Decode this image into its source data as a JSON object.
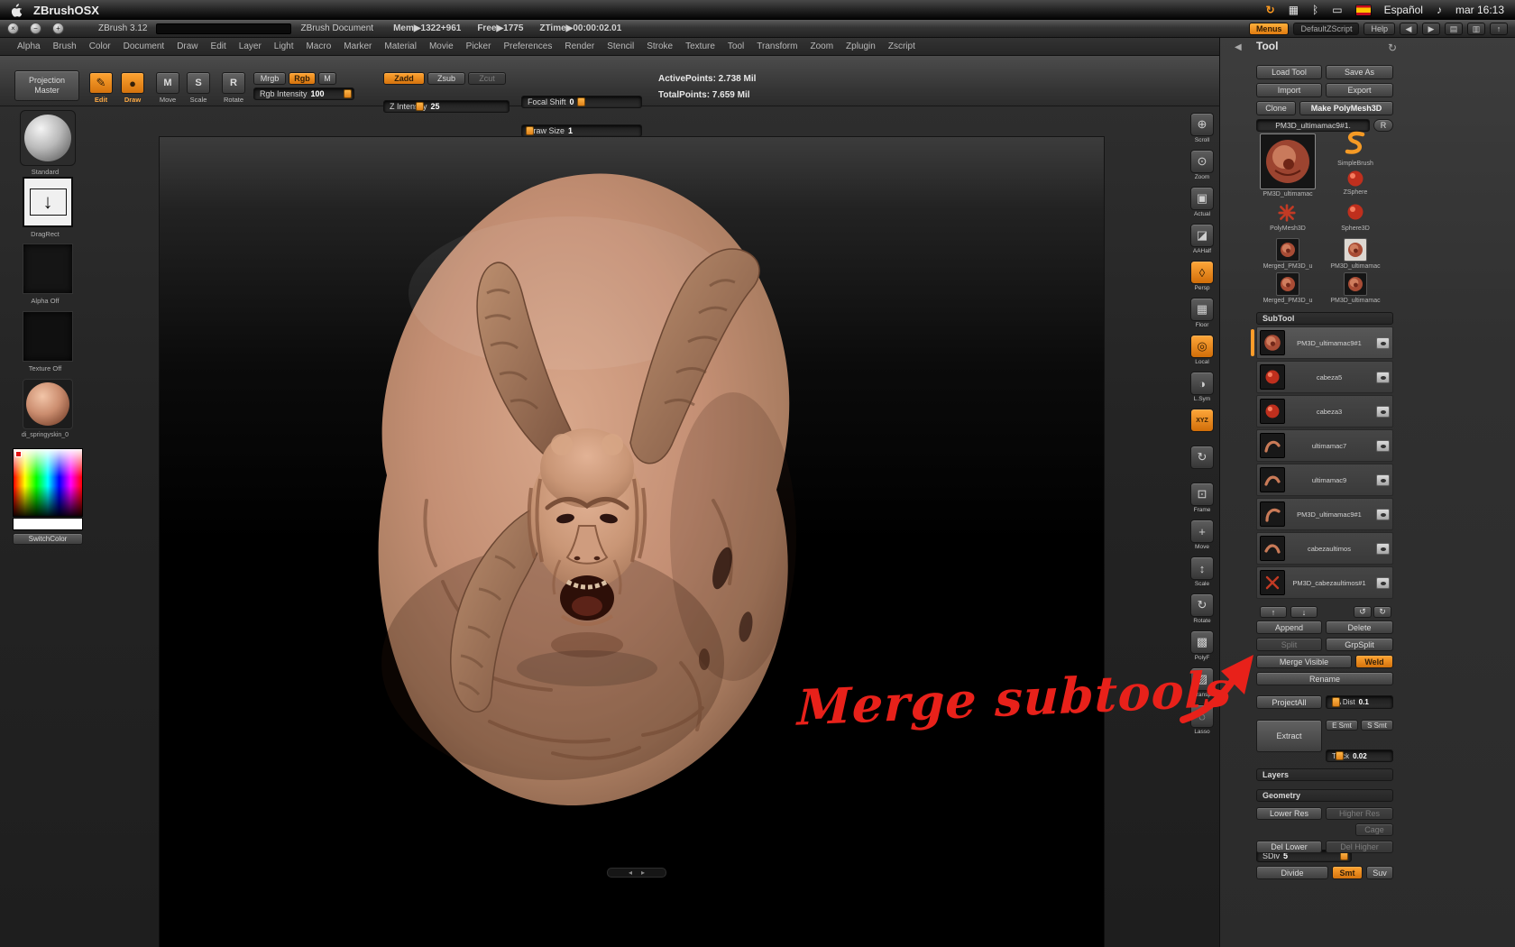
{
  "colors": {
    "accent": "#f09325",
    "annotation_red": "#e8211a",
    "flesh": "#c08a70",
    "panel_bg": "#3a3a3a"
  },
  "macbar": {
    "app_name": "ZBrushOSX",
    "language": "Español",
    "clock": "mar 16:13"
  },
  "icons": {
    "close": "×",
    "minimize": "−",
    "zoom_btn": "+",
    "sync": "↻",
    "spaces": "▦",
    "bluetooth": "ᛒ",
    "display": "▭",
    "volume": "♪",
    "nav_back": "◀",
    "nav_fwd": "▶",
    "page_a": "▤",
    "page_b": "▥",
    "up": "↑",
    "tray_collapse": "◀",
    "tray_reset": "↻",
    "edit": "✎",
    "draw": "●",
    "move": "M",
    "scale": "S",
    "rotate": "R",
    "drag_arrow": "↓",
    "subtool_up": "↑",
    "subtool_down": "↓",
    "subtool_undo": "↺",
    "subtool_redo": "↻",
    "canvas_scroll_left": "◂",
    "canvas_scroll_right": "▸"
  },
  "titlebar": {
    "version": "ZBrush 3.12",
    "doc_title": "ZBrush Document",
    "mem": "Mem▶1322+961",
    "free": "Free▶1775",
    "ztime": "ZTime▶00:00:02.01",
    "menus": "Menus",
    "zscript": "DefaultZScript",
    "help": "Help"
  },
  "menubar": {
    "items": [
      "Alpha",
      "Brush",
      "Color",
      "Document",
      "Draw",
      "Edit",
      "Layer",
      "Light",
      "Macro",
      "Marker",
      "Material",
      "Movie",
      "Picker",
      "Preferences",
      "Render",
      "Stencil",
      "Stroke",
      "Texture",
      "Tool",
      "Transform",
      "Zoom",
      "Zplugin",
      "Zscript"
    ]
  },
  "shelf": {
    "projection_line1": "Projection",
    "projection_line2": "Master",
    "edit": "Edit",
    "draw": "Draw",
    "move": "Move",
    "scale": "Scale",
    "rotate": "Rotate",
    "mrgb": "Mrgb",
    "rgb": "Rgb",
    "m": "M",
    "rgb_intensity": "Rgb Intensity",
    "rgb_intensity_value": "100",
    "zadd": "Zadd",
    "zsub": "Zsub",
    "zcut": "Zcut",
    "z_intensity": "Z Intensity",
    "z_intensity_value": "25",
    "focal_shift": "Focal Shift",
    "focal_shift_value": "0",
    "draw_size": "Draw Size",
    "draw_size_value": "1",
    "active_points": "ActivePoints: 2.738 Mil",
    "total_points": "TotalPoints: 7.659 Mil"
  },
  "left_shelf": {
    "brush_label": "Standard",
    "stroke_label": "DragRect",
    "alpha_label": "Alpha Off",
    "texture_label": "Texture Off",
    "material_label": "di_springyskin_0",
    "switch_color": "SwitchColor"
  },
  "right_strip": {
    "items": [
      {
        "label": "Scroll",
        "glyph": "⊕"
      },
      {
        "label": "Zoom",
        "glyph": "⊙"
      },
      {
        "label": "Actual",
        "glyph": "▣"
      },
      {
        "label": "AAHalf",
        "glyph": "◪"
      },
      {
        "label": "Persp",
        "glyph": "◊"
      },
      {
        "label": "Floor",
        "glyph": "▦"
      },
      {
        "label": "Local",
        "glyph": "◎"
      },
      {
        "label": "L.Sym",
        "glyph": "◑"
      },
      {
        "label": "",
        "glyph": "XYZ"
      },
      {
        "label": "",
        "glyph": "↻"
      },
      {
        "label": "Frame",
        "glyph": "⊡"
      },
      {
        "label": "Move",
        "glyph": "+"
      },
      {
        "label": "Scale",
        "glyph": "↕"
      },
      {
        "label": "Rotate",
        "glyph": "↻"
      },
      {
        "label": "PolyF",
        "glyph": "▩"
      },
      {
        "label": "Transp",
        "glyph": "▨"
      },
      {
        "label": "Lasso",
        "glyph": "◌"
      }
    ]
  },
  "tool_panel": {
    "title": "Tool",
    "load_tool": "Load Tool",
    "save_as": "Save As",
    "import": "Import",
    "export": "Export",
    "clone": "Clone",
    "make_polymesh3d": "Make PolyMesh3D",
    "current_tool": "PM3D_ultimamac9#1.",
    "r_button": "R",
    "inventory": {
      "active_label": "PM3D_ultimamac",
      "simplebrush": "SimpleBrush",
      "zsphere": "ZSphere",
      "polymesh3d": "PolyMesh3D",
      "sphere3d": "Sphere3D",
      "merged_a": "Merged_PM3D_u",
      "ultimamac_a": "PM3D_ultimamac",
      "merged_b": "Merged_PM3D_u",
      "ultimamac_b": "PM3D_ultimamac"
    },
    "subtool": {
      "header": "SubTool",
      "items": [
        {
          "name": "PM3D_ultimamac9#1"
        },
        {
          "name": "cabeza5"
        },
        {
          "name": "cabeza3"
        },
        {
          "name": "ultimamac7"
        },
        {
          "name": "ultimamac9"
        },
        {
          "name": "PM3D_ultimamac9#1"
        },
        {
          "name": "cabezaultimos"
        },
        {
          "name": "PM3D_cabezaultimos#1"
        }
      ],
      "append": "Append",
      "delete": "Delete",
      "split": "Split",
      "grpsplit": "GrpSplit",
      "merge_visible": "Merge Visible",
      "weld": "Weld",
      "rename": "Rename",
      "projectall": "ProjectAll",
      "pa_dist_label": "PA Dist",
      "pa_dist_value": "0.1",
      "extract": "Extract",
      "e_smt": "E Smt",
      "s_smt": "S Smt",
      "thick_label": "Thick",
      "thick_value": "0.02"
    },
    "layers_header": "Layers",
    "geometry": {
      "header": "Geometry",
      "lower_res": "Lower Res",
      "higher_res": "Higher Res",
      "sdiv_label": "SDiv",
      "sdiv_value": "5",
      "cage": "Cage",
      "del_lower": "Del Lower",
      "del_higher": "Del Higher",
      "divide": "Divide",
      "smt": "Smt",
      "suv": "Suv"
    }
  },
  "annotation": {
    "text": "Merge subtools"
  }
}
